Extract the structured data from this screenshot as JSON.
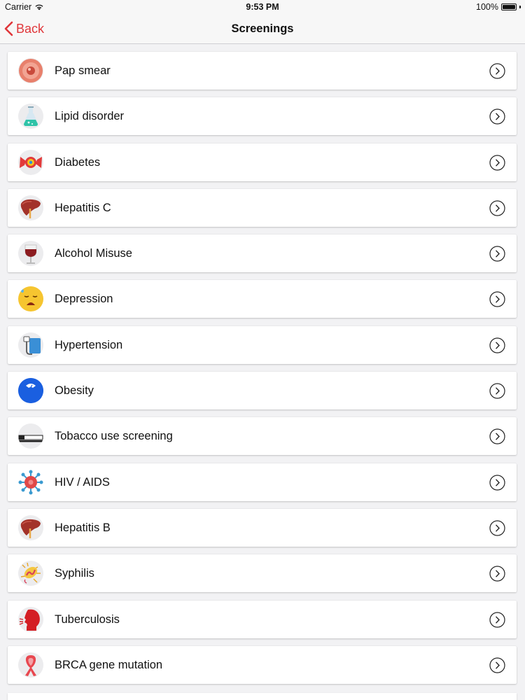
{
  "status": {
    "carrier": "Carrier",
    "time": "9:53 PM",
    "battery": "100%"
  },
  "nav": {
    "back_label": "Back",
    "title": "Screenings"
  },
  "items": [
    {
      "label": "Pap smear",
      "icon": "cell-icon"
    },
    {
      "label": "Lipid disorder",
      "icon": "flask-icon"
    },
    {
      "label": "Diabetes",
      "icon": "candy-icon"
    },
    {
      "label": "Hepatitis C",
      "icon": "liver-icon"
    },
    {
      "label": "Alcohol Misuse",
      "icon": "wine-glass-icon"
    },
    {
      "label": "Depression",
      "icon": "sad-face-icon"
    },
    {
      "label": "Hypertension",
      "icon": "blood-pressure-icon"
    },
    {
      "label": "Obesity",
      "icon": "scale-icon"
    },
    {
      "label": "Tobacco use screening",
      "icon": "cigarette-icon"
    },
    {
      "label": "HIV / AIDS",
      "icon": "virus-icon"
    },
    {
      "label": "Hepatitis B",
      "icon": "liver-icon"
    },
    {
      "label": "Syphilis",
      "icon": "bacterium-icon"
    },
    {
      "label": "Tuberculosis",
      "icon": "coughing-head-icon"
    },
    {
      "label": "BRCA gene mutation",
      "icon": "ribbon-icon"
    }
  ],
  "colors": {
    "accent": "#e0363a",
    "background": "#f2f2f4",
    "card": "#ffffff"
  }
}
